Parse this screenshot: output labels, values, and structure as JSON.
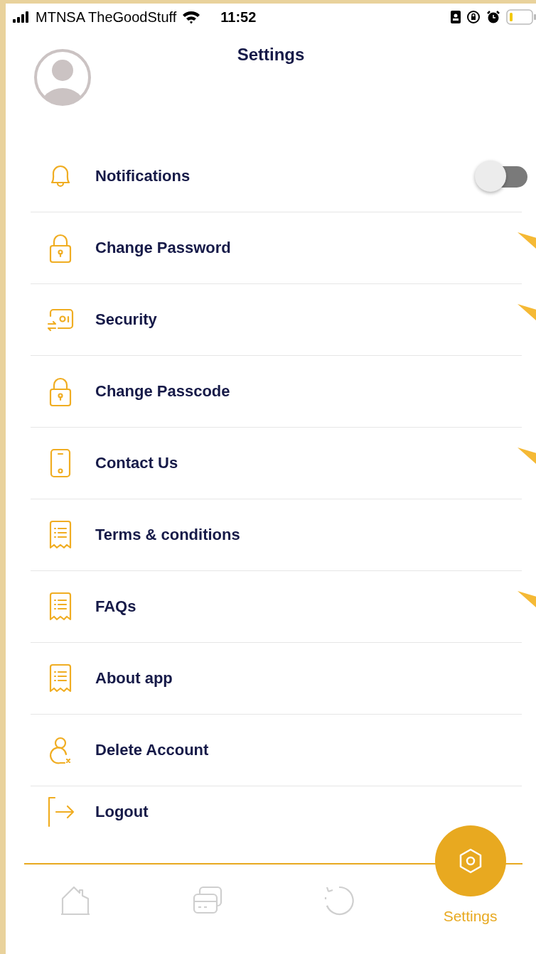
{
  "status_bar": {
    "carrier": "MTNSA TheGoodStuff",
    "time": "11:52"
  },
  "title": "Settings",
  "items": [
    {
      "label": "Notifications",
      "kind": "toggle",
      "on": false,
      "marked": false
    },
    {
      "label": "Change Password",
      "kind": "link",
      "marked": true
    },
    {
      "label": "Security",
      "kind": "link",
      "marked": true
    },
    {
      "label": "Change Passcode",
      "kind": "link",
      "marked": false
    },
    {
      "label": "Contact Us",
      "kind": "link",
      "marked": true
    },
    {
      "label": "Terms & conditions",
      "kind": "link",
      "marked": false
    },
    {
      "label": "FAQs",
      "kind": "link",
      "marked": true
    },
    {
      "label": "About app",
      "kind": "link",
      "marked": false
    },
    {
      "label": "Delete Account",
      "kind": "link",
      "marked": false
    },
    {
      "label": "Logout",
      "kind": "link",
      "marked": false
    }
  ],
  "nav": [
    {
      "selected": false
    },
    {
      "selected": false
    },
    {
      "selected": false
    },
    {
      "label": "Settings",
      "selected": true
    }
  ]
}
